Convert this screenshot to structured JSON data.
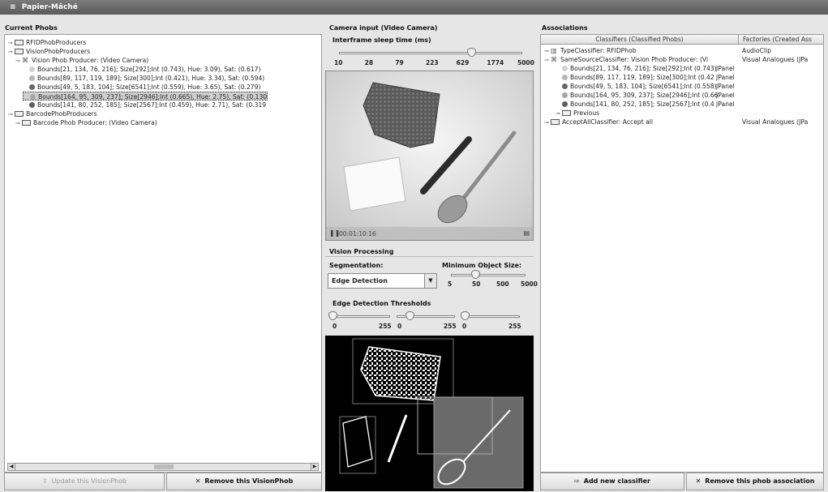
{
  "window": {
    "title": "Papier-Mâché"
  },
  "current_phobs": {
    "title": "Current Phobs",
    "tree": [
      {
        "label": "RFIDPhobProducers",
        "level": 0,
        "icon": "folder-icon"
      },
      {
        "label": "VisionPhobProducers",
        "level": 0,
        "icon": "folder-icon"
      },
      {
        "label": "Vision Phob Producer: (Video Camera)",
        "level": 1,
        "icon": "camera-icon"
      },
      {
        "label": "Bounds[21, 134, 76, 216]; Size[292];Int (0.743), Hue: 3.09),  Sat: (0.617)",
        "level": 2,
        "icon": "dot-icon",
        "color": "#d2d2d2"
      },
      {
        "label": "Bounds[89, 117, 119, 189]; Size[300];Int (0.421), Hue: 3.34),  Sat: (0.594)",
        "level": 2,
        "icon": "dot-icon",
        "color": "#b6b6b6"
      },
      {
        "label": "Bounds[49, 5, 183, 104]; Size[6541];Int (0.559), Hue: 3.65),  Sat: (0.279)",
        "level": 2,
        "icon": "dot-icon",
        "color": "#666666"
      },
      {
        "label": "Bounds[164, 95, 309, 237]; Size[2946];Int (0.665), Hue: 2.75),  Sat: (0.130",
        "level": 2,
        "icon": "dot-icon",
        "color": "#a6a6a6",
        "selected": true
      },
      {
        "label": "Bounds[141, 80, 252, 185]; Size[2567];Int (0.459), Hue: 2.71),  Sat: (0.319",
        "level": 2,
        "icon": "dot-icon",
        "color": "#5e5e5e"
      },
      {
        "label": "BarcodePhobProducers",
        "level": 0,
        "icon": "folder-icon"
      },
      {
        "label": "Barcode Phob Producer: (Video Camera)",
        "level": 1,
        "icon": "folder-icon"
      }
    ],
    "buttons": {
      "update": "Update this VisionPhob",
      "remove": "Remove this VisionPhob"
    }
  },
  "camera": {
    "title": "Camera input (Video Camera)",
    "sleep_label": "Interframe sleep time (ms)",
    "sleep_ticks": [
      "10",
      "28",
      "79",
      "223",
      "629",
      "1774",
      "5000"
    ],
    "sleep_value": 0.72,
    "timecode": "00:01:10:16"
  },
  "vision": {
    "title": "Vision Processing",
    "segmentation_label": "Segmentation:",
    "segmentation_value": "Edge Detection",
    "min_size_label": "Minimum Object Size:",
    "min_size_ticks": [
      "5",
      "50",
      "500",
      "5000"
    ],
    "min_size_value": 0.33,
    "thresholds_label": "Edge Detection Thresholds",
    "threshold_ticks": [
      [
        "0",
        "255"
      ],
      [
        "0",
        "255"
      ],
      [
        "0",
        "255"
      ]
    ],
    "threshold_values": [
      0.02,
      0.22,
      0.06
    ]
  },
  "associations": {
    "title": "Associations",
    "columns": [
      "Classifiers (Classified Phobs)",
      "Factories (Created Ass"
    ],
    "rows": [
      {
        "label": "TypeClassifier: RFIDPhob",
        "factory": "AudioClip",
        "level": 0,
        "icon": "barcode-icon"
      },
      {
        "label": "SameSourceClassifier: Vision Phob Producer: (Vi",
        "factory": "Visual Analogues (JPa",
        "level": 0,
        "icon": "camera-icon"
      },
      {
        "label": "Bounds[21, 134, 76, 216]; Size[292];Int (0.743)",
        "factory": "JPanel",
        "level": 1,
        "icon": "dot-icon",
        "color": "#d2d2d2"
      },
      {
        "label": "Bounds[89, 117, 119, 189]; Size[300];Int (0.42",
        "factory": "JPanel",
        "level": 1,
        "icon": "dot-icon",
        "color": "#b6b6b6"
      },
      {
        "label": "Bounds[49, 5, 183, 104]; Size[6541];Int (0.558)",
        "factory": "JPanel",
        "level": 1,
        "icon": "dot-icon",
        "color": "#666666"
      },
      {
        "label": "Bounds[164, 95, 309, 237]; Size[2946];Int (0.66",
        "factory": "JPanel",
        "level": 1,
        "icon": "dot-icon",
        "color": "#a6a6a6"
      },
      {
        "label": "Bounds[141, 80, 252, 185]; Size[2567];Int (0.4",
        "factory": "JPanel",
        "level": 1,
        "icon": "dot-icon",
        "color": "#5e5e5e"
      },
      {
        "label": "Previous",
        "factory": "",
        "level": 1,
        "icon": "folder-icon"
      },
      {
        "label": "AcceptAllClassifier: Accept all",
        "factory": "Visual Analogues (JPa",
        "level": 0,
        "icon": "folder-icon"
      }
    ],
    "buttons": {
      "add": "Add new classifier",
      "remove": "Remove this phob association"
    }
  }
}
